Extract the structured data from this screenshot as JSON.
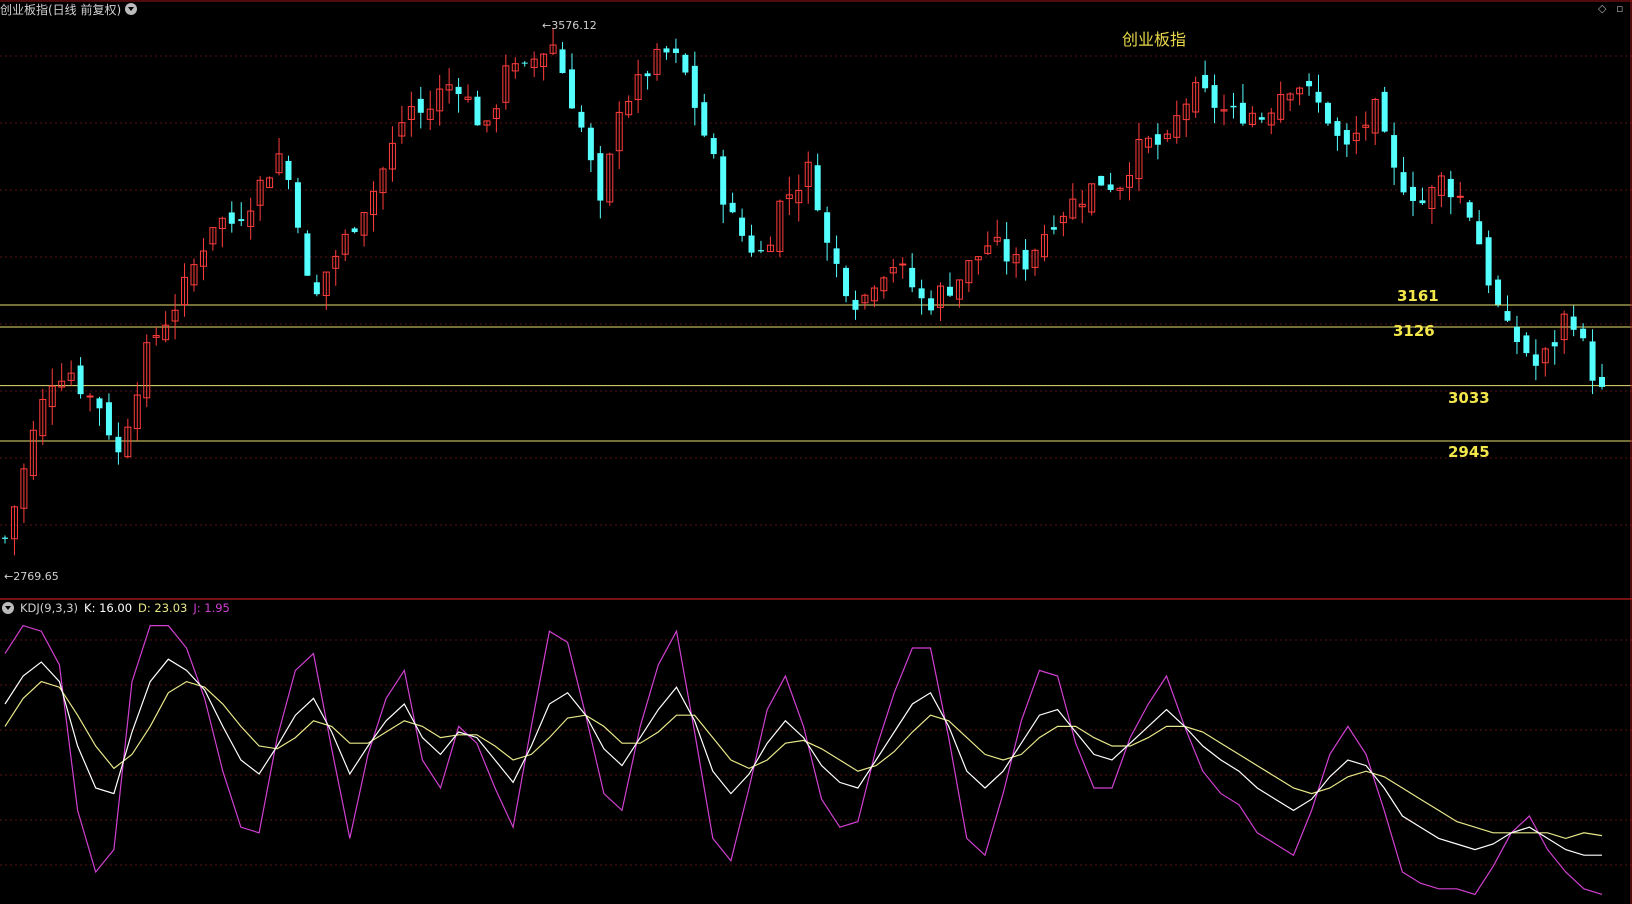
{
  "header": {
    "title": "创业板指(日线 前复权)",
    "chart_title": "创业板指",
    "high_mark": "3576.12",
    "low_mark": "2769.65"
  },
  "kdj": {
    "label": "KDJ(9,3,3)",
    "k_text": "K: 16.00",
    "d_text": "D: 23.03",
    "j_text": "J: 1.95"
  },
  "colors": {
    "up": "#ff3d3d",
    "down": "#54ffff",
    "k_line": "#ffffff",
    "d_line": "#e8e88a",
    "j_line": "#d040d0",
    "level_line": "#e8e070",
    "frame": "#a01818"
  },
  "chart_data": {
    "type": "candlestick",
    "y_range": [
      2700,
      3620
    ],
    "levels": [
      {
        "value": 3161,
        "label": "3161"
      },
      {
        "value": 3126,
        "label": "3126"
      },
      {
        "value": 3033,
        "label": "3033"
      },
      {
        "value": 2945,
        "label": "2945"
      }
    ],
    "close_path": [
      2790,
      2880,
      2980,
      3050,
      3060,
      3020,
      3000,
      2920,
      3020,
      3100,
      3140,
      3180,
      3240,
      3300,
      3290,
      3320,
      3360,
      3400,
      3330,
      3150,
      3220,
      3260,
      3310,
      3350,
      3410,
      3480,
      3460,
      3500,
      3520,
      3470,
      3430,
      3550,
      3520,
      3560,
      3576,
      3500,
      3420,
      3300,
      3480,
      3500,
      3540,
      3560,
      3540,
      3460,
      3380,
      3300,
      3260,
      3240,
      3320,
      3350,
      3380,
      3250,
      3200,
      3160,
      3210,
      3230,
      3200,
      3160,
      3180,
      3200,
      3230,
      3260,
      3240,
      3220,
      3260,
      3300,
      3320,
      3340,
      3360,
      3350,
      3400,
      3420,
      3410,
      3480,
      3500,
      3480,
      3460,
      3470,
      3460,
      3500,
      3520,
      3490,
      3460,
      3400,
      3440,
      3470,
      3370,
      3350,
      3320,
      3360,
      3340,
      3300,
      3200,
      3120,
      3100,
      3060,
      3100,
      3160,
      3080,
      3020
    ],
    "kdj": {
      "K": [
        70,
        80,
        85,
        78,
        55,
        40,
        38,
        60,
        78,
        86,
        82,
        75,
        62,
        50,
        45,
        55,
        66,
        72,
        60,
        45,
        55,
        64,
        70,
        58,
        52,
        60,
        58,
        50,
        42,
        55,
        70,
        74,
        66,
        54,
        48,
        58,
        68,
        76,
        64,
        46,
        38,
        45,
        56,
        64,
        58,
        48,
        42,
        40,
        50,
        60,
        70,
        74,
        62,
        46,
        40,
        46,
        56,
        66,
        68,
        60,
        52,
        50,
        56,
        62,
        68,
        62,
        55,
        50,
        46,
        40,
        36,
        32,
        36,
        44,
        50,
        48,
        40,
        30,
        26,
        22,
        20,
        18,
        20,
        24,
        26,
        22,
        18,
        16,
        16
      ],
      "D": [
        62,
        72,
        78,
        76,
        66,
        55,
        47,
        52,
        62,
        74,
        78,
        76,
        70,
        62,
        55,
        54,
        58,
        64,
        62,
        56,
        56,
        60,
        64,
        62,
        58,
        59,
        59,
        55,
        50,
        52,
        58,
        65,
        66,
        62,
        56,
        56,
        60,
        66,
        66,
        58,
        50,
        47,
        50,
        56,
        57,
        54,
        50,
        46,
        48,
        53,
        60,
        66,
        64,
        58,
        52,
        50,
        52,
        58,
        62,
        62,
        58,
        55,
        55,
        58,
        62,
        62,
        60,
        56,
        52,
        48,
        44,
        40,
        38,
        40,
        44,
        46,
        44,
        40,
        36,
        32,
        28,
        26,
        24,
        24,
        24,
        24,
        22,
        24,
        23
      ],
      "J": [
        88,
        98,
        96,
        84,
        32,
        10,
        18,
        78,
        98,
        98,
        90,
        72,
        46,
        26,
        24,
        58,
        82,
        88,
        54,
        22,
        52,
        72,
        82,
        50,
        40,
        62,
        56,
        40,
        26,
        62,
        96,
        92,
        66,
        38,
        32,
        62,
        84,
        96,
        60,
        22,
        14,
        40,
        68,
        80,
        62,
        36,
        26,
        28,
        54,
        74,
        90,
        90,
        58,
        22,
        16,
        38,
        64,
        82,
        80,
        56,
        40,
        40,
        58,
        70,
        80,
        62,
        46,
        38,
        34,
        24,
        20,
        16,
        32,
        52,
        62,
        52,
        32,
        10,
        6,
        4,
        4,
        2,
        12,
        24,
        30,
        18,
        10,
        4,
        2
      ]
    }
  }
}
